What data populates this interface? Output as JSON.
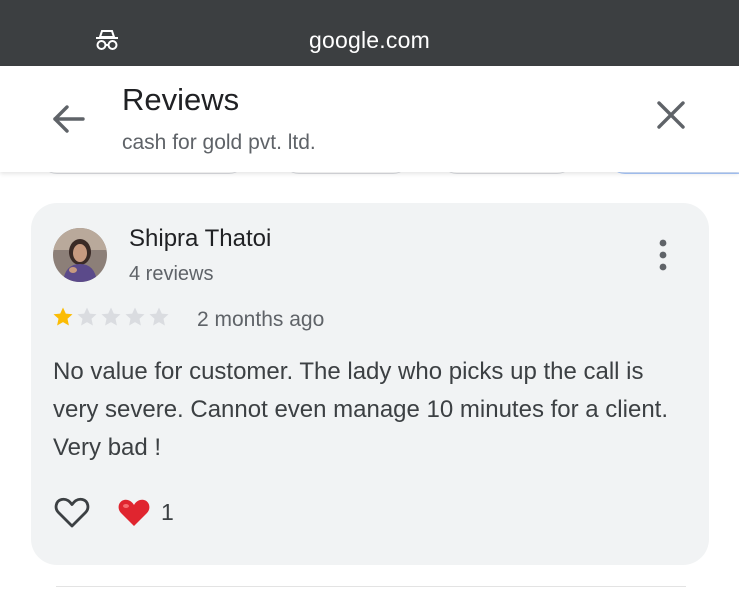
{
  "browser": {
    "url": "google.com",
    "icon": "incognito-icon"
  },
  "header": {
    "title": "Reviews",
    "subtitle": "cash for gold pvt. ltd.",
    "back_icon": "arrow-back-icon",
    "close_icon": "close-icon"
  },
  "review": {
    "reviewer_name": "Shipra Thatoi",
    "reviewer_review_count": "4 reviews",
    "rating": 1,
    "rating_max": 5,
    "time_ago": "2 months ago",
    "text": "No value for customer. The lady who picks up the call is very severe. Cannot even manage 10 minutes for a client. Very bad !",
    "reaction_count": "1"
  },
  "colors": {
    "topbar": "#3c3f41",
    "card": "#f1f3f4",
    "star_filled": "#fbbc04",
    "star_empty": "#dadce0",
    "heart": "#e0252f"
  }
}
